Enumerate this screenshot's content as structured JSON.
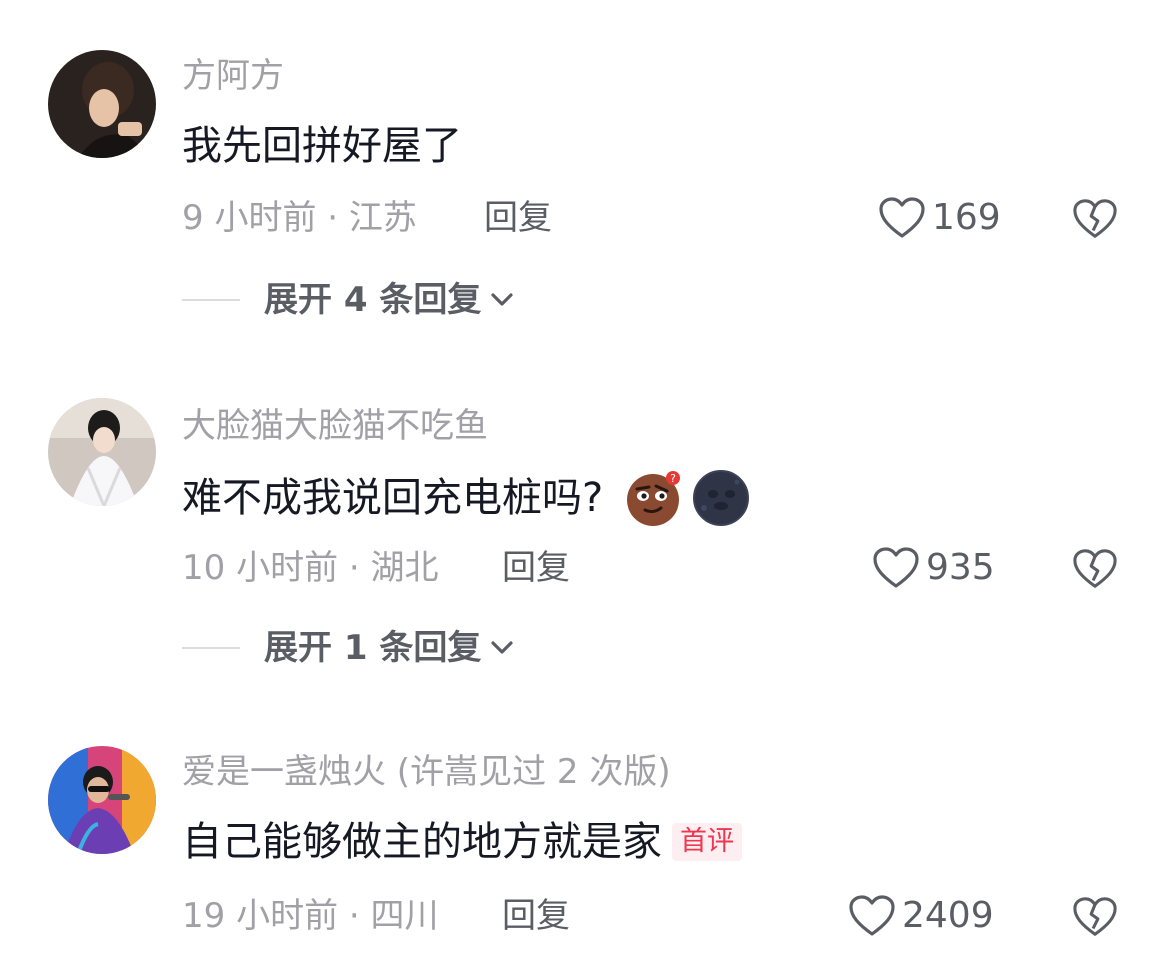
{
  "comments": [
    {
      "username": "方阿方",
      "text": "我先回拼好屋了",
      "meta": "9 小时前 · 江苏",
      "reply_label": "回复",
      "likes": "169",
      "expand_label": "展开 4 条回复",
      "emojis": [],
      "badge": ""
    },
    {
      "username": "大脸猫大脸猫不吃鱼",
      "text": "难不成我说回充电桩吗?",
      "meta": "10 小时前 · 湖北",
      "reply_label": "回复",
      "likes": "935",
      "expand_label": "展开 1 条回复",
      "emojis": [
        "thinking-face-emoji",
        "new-moon-face-emoji"
      ],
      "badge": ""
    },
    {
      "username": "爱是一盏烛火 (许嵩见过 2 次版)",
      "text": "自己能够做主的地方就是家",
      "meta": "19 小时前 · 四川",
      "reply_label": "回复",
      "likes": "2409",
      "expand_label": "",
      "emojis": [],
      "badge": "首评"
    }
  ],
  "colors": {
    "text_primary": "#161823",
    "text_secondary": "#a0a0a6",
    "action": "#5b5d65",
    "badge_text": "#f0364f",
    "badge_bg": "#fdeef1"
  },
  "icons": {
    "like": "heart-outline-icon",
    "dislike": "broken-heart-icon",
    "expand": "chevron-down-icon"
  }
}
